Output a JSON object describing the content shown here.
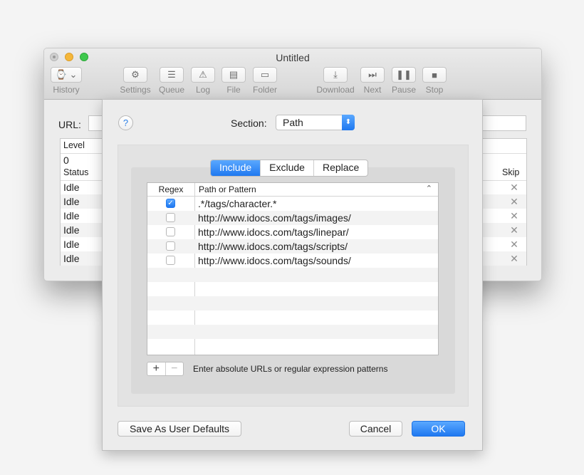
{
  "window": {
    "title": "Untitled"
  },
  "toolbar": {
    "items": [
      {
        "label": "History",
        "icon": "history-icon",
        "glyph": "⌚ ⌄"
      },
      {
        "label": "Settings",
        "icon": "gear-icon",
        "glyph": "⚙"
      },
      {
        "label": "Queue",
        "icon": "list-icon",
        "glyph": "☰"
      },
      {
        "label": "Log",
        "icon": "warning-icon",
        "glyph": "⚠"
      },
      {
        "label": "File",
        "icon": "file-icon",
        "glyph": "▤"
      },
      {
        "label": "Folder",
        "icon": "folder-icon",
        "glyph": "▭"
      },
      {
        "label": "Download",
        "icon": "download-icon",
        "glyph": "⤓"
      },
      {
        "label": "Next",
        "icon": "next-icon",
        "glyph": "⏭"
      },
      {
        "label": "Pause",
        "icon": "pause-icon",
        "glyph": "❚❚"
      },
      {
        "label": "Stop",
        "icon": "stop-icon",
        "glyph": "■"
      }
    ]
  },
  "main": {
    "url_label": "URL:",
    "level_header": "Level",
    "level_value": "0",
    "status_header": "Status",
    "skip_header": "Skip",
    "statuses": [
      "Idle",
      "Idle",
      "Idle",
      "Idle",
      "Idle",
      "Idle"
    ]
  },
  "sheet": {
    "help": "?",
    "section_label": "Section:",
    "section_value": "Path",
    "tabs": [
      "Include",
      "Exclude",
      "Replace"
    ],
    "active_tab": "Include",
    "table": {
      "col_regex": "Regex",
      "col_path": "Path or Pattern",
      "rows": [
        {
          "regex": true,
          "pattern": ".*/tags/character.*"
        },
        {
          "regex": false,
          "pattern": "http://www.idocs.com/tags/images/"
        },
        {
          "regex": false,
          "pattern": "http://www.idocs.com/tags/linepar/"
        },
        {
          "regex": false,
          "pattern": "http://www.idocs.com/tags/scripts/"
        },
        {
          "regex": false,
          "pattern": "http://www.idocs.com/tags/sounds/"
        }
      ]
    },
    "add_label": "+",
    "remove_label": "−",
    "hint": "Enter absolute URLs or regular expression patterns",
    "save_defaults": "Save As User Defaults",
    "cancel": "Cancel",
    "ok": "OK"
  },
  "colors": {
    "accent": "#1f78f0",
    "accent_light": "#5aa8ff"
  }
}
